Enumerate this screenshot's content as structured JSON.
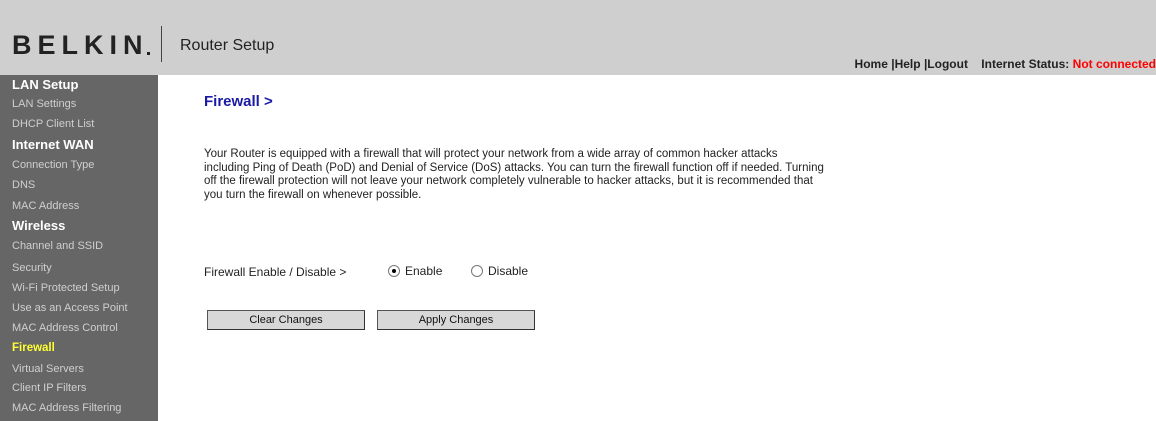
{
  "header": {
    "logo": "BELKIN",
    "app_title": "Router Setup",
    "links": [
      "Home",
      "Help",
      "Logout"
    ],
    "separator": "|",
    "status_label": "Internet Status:",
    "status_value": "Not connected"
  },
  "sidebar": {
    "sections": [
      {
        "heading": "LAN Setup",
        "items": [
          "LAN Settings",
          "DHCP Client List"
        ]
      },
      {
        "heading": "Internet WAN",
        "items": [
          "Connection Type",
          "DNS",
          "MAC Address"
        ]
      },
      {
        "heading": "Wireless",
        "items": [
          "Channel and SSID",
          "Security",
          "Wi-Fi Protected Setup",
          "Use as an Access Point",
          "MAC Address Control"
        ]
      }
    ],
    "firewall_heading": "Firewall",
    "firewall_items": [
      "Virtual Servers",
      "Client IP Filters",
      "MAC Address Filtering"
    ]
  },
  "main": {
    "title": "Firewall >",
    "description": "Your Router is equipped with a firewall that will protect your network from a wide array of common hacker attacks including Ping of Death (PoD) and Denial of Service (DoS) attacks. You can turn the firewall function off if needed. Turning off the firewall protection will not leave your network completely vulnerable to hacker attacks, but it is recommended that you turn the firewall on whenever possible.",
    "firewall_label": "Firewall Enable / Disable >",
    "options": [
      "Enable",
      "Disable"
    ],
    "selected": "Enable",
    "clear_button": "Clear Changes",
    "apply_button": "Apply Changes"
  },
  "colors": {
    "header_bg": "#cfcfcf",
    "sidebar_bg": "#666666",
    "active_item": "#ffff33",
    "title_blue": "#1a1aa6",
    "status_red": "#ff0000"
  }
}
